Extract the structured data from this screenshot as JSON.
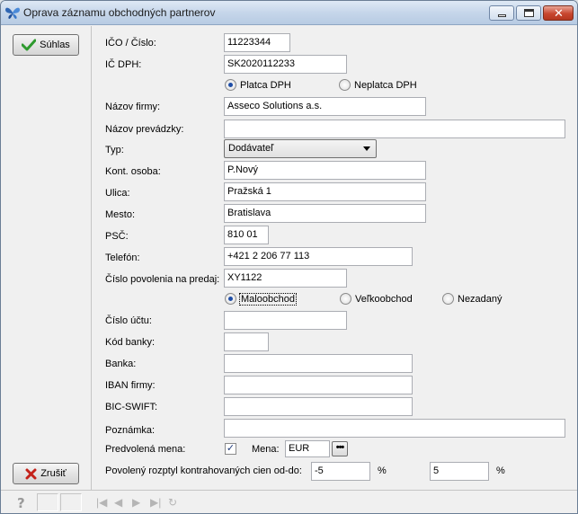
{
  "window": {
    "title": "Oprava záznamu obchodných partnerov",
    "accent": "#2a62b8"
  },
  "buttons": {
    "accept_label": "Súhlas",
    "cancel_label": "Zrušiť"
  },
  "form": {
    "ico": {
      "label": "IČO / Číslo:",
      "value": "11223344"
    },
    "ic_dph": {
      "label": "IČ DPH:",
      "value": "SK2020112233"
    },
    "dph_radio": {
      "option1": "Platca DPH",
      "option2": "Neplatca DPH",
      "selected": "Platca DPH"
    },
    "firm_name": {
      "label": "Názov firmy:",
      "value": "Asseco Solutions a.s."
    },
    "shop_name": {
      "label": "Názov prevádzky:",
      "value": ""
    },
    "type": {
      "label": "Typ:",
      "value": "Dodávateľ"
    },
    "contact": {
      "label": "Kont. osoba:",
      "value": "P.Nový"
    },
    "street": {
      "label": "Ulica:",
      "value": "Pražská 1"
    },
    "city": {
      "label": "Mesto:",
      "value": "Bratislava"
    },
    "zip": {
      "label": "PSČ:",
      "value": "810 01"
    },
    "phone": {
      "label": "Telefón:",
      "value": "+421 2 206 77 113"
    },
    "sale_permit": {
      "label": "Číslo povolenia na predaj:",
      "value": "XY1122"
    },
    "sale_radio": {
      "option1": "Maloobchod",
      "option2": "Veľkoobchod",
      "option3": "Nezadaný",
      "selected": "Maloobchod"
    },
    "account": {
      "label": "Číslo účtu:",
      "value": ""
    },
    "bank_code": {
      "label": "Kód banky:",
      "value": ""
    },
    "bank": {
      "label": "Banka:",
      "value": ""
    },
    "iban": {
      "label": "IBAN firmy:",
      "value": ""
    },
    "bic": {
      "label": "BIC-SWIFT:",
      "value": ""
    },
    "note": {
      "label": "Poznámka:",
      "value": ""
    },
    "default_currency": {
      "label": "Predvolená mena:",
      "checked": true,
      "mena_label": "Mena:",
      "mena_value": "EUR"
    },
    "range": {
      "label": "Povolený rozptyl kontrahovaných cien od-do:",
      "from": "-5",
      "to": "5",
      "unit": "%"
    }
  }
}
